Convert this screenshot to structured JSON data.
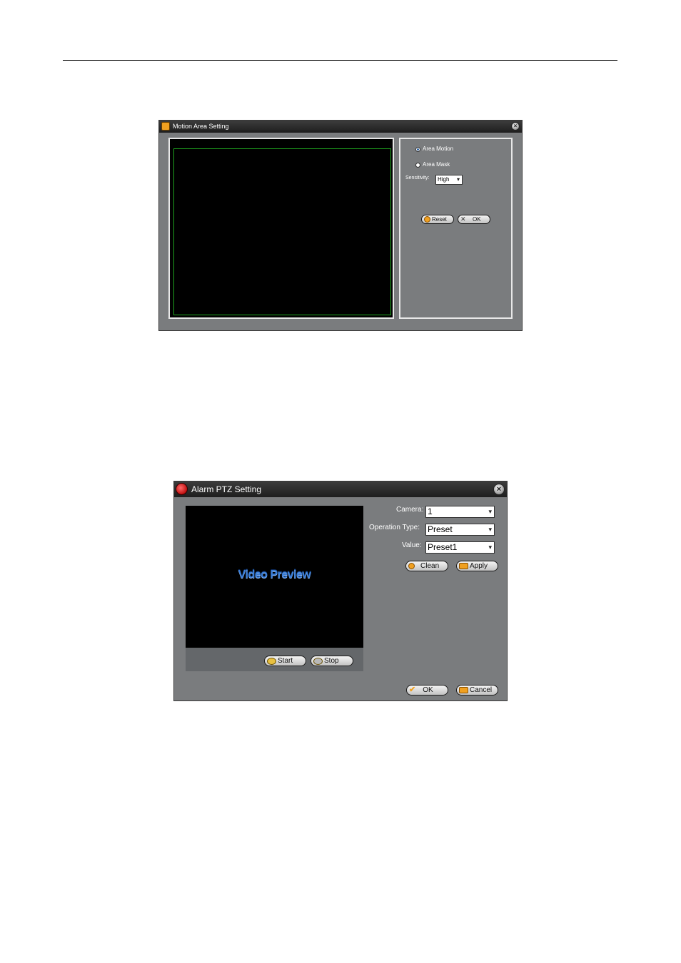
{
  "dialog1": {
    "title": "Motion Area Setting",
    "radio_area_motion": "Area Motion",
    "radio_area_mask": "Area Mask",
    "sensitivity_label": "Sensitivity:",
    "sensitivity_value": "High",
    "reset_button": "Reset",
    "ok_button": "OK",
    "selected_radio": "Area Motion"
  },
  "dialog2": {
    "title": "Alarm PTZ Setting",
    "preview_text": "Video Preview",
    "start_button": "Start",
    "stop_button": "Stop",
    "camera_label": "Camera:",
    "camera_value": "1",
    "operation_type_label": "Operation Type:",
    "operation_type_value": "Preset",
    "value_label": "Value:",
    "value_value": "Preset1",
    "clean_button": "Clean",
    "apply_button": "Apply",
    "ok_button": "OK",
    "cancel_button": "Cancel"
  },
  "colors": {
    "dialog_body": "#7a7c7e",
    "titlebar": "#2a2a2a",
    "motion_grid": "#1fa31f",
    "preview_text": "#3a7ed8",
    "icon_accent": "#f0a020"
  },
  "icons": {
    "dialog1_title_icon": "motion-camera-icon",
    "dialog2_title_icon": "alarm-ptz-icon",
    "reset_icon": "reset-icon",
    "ok_icon": "close-x-icon",
    "clean_icon": "clean-icon",
    "apply_icon": "apply-icon",
    "start_icon": "start-record-icon",
    "stop_icon": "stop-record-icon",
    "ok_check_icon": "check-icon",
    "cancel_icon": "cancel-arrow-icon"
  }
}
